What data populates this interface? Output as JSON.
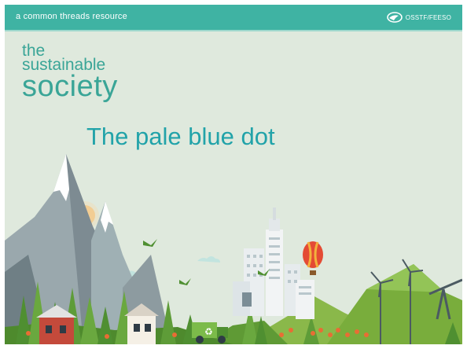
{
  "header": {
    "tagline": "a common threads resource",
    "logo_text": "OSSTF/FEESO",
    "logo_icon": "osstf-logo-icon",
    "bar_color": "#3fb3a3"
  },
  "brand": {
    "line1": "the",
    "line2": "sustainable",
    "line3": "society",
    "color": "#3aa597"
  },
  "slide": {
    "title": "The pale blue dot",
    "title_color": "#22a3a9",
    "background": "#dfe9dd"
  },
  "illustration": {
    "elements": [
      "mountains",
      "sun",
      "clouds",
      "birds",
      "city-buildings",
      "hot-air-balloon",
      "wind-turbines",
      "oil-pump",
      "recycling-truck",
      "houses",
      "trees",
      "flowers"
    ]
  }
}
